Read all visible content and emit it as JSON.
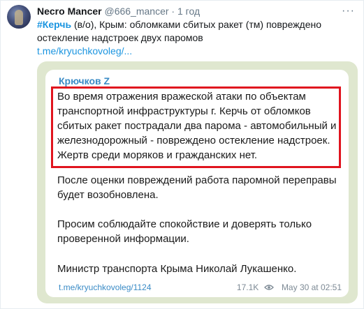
{
  "tweet": {
    "author_name": "Necro Mancer",
    "author_handle": "@666_mancer",
    "separator": " · ",
    "time": "1 год",
    "hashtag": "#Керчь",
    "text": " (в/о), Крым: обломками сбитых ракет (тм) повреждено остекление надстроек двух паромов",
    "link": "t.me/kryuchkovoleg/..."
  },
  "telegram_post": {
    "channel": "Крючков Z",
    "paragraphs": [
      "Во время отражения вражеской атаки по объектам транспортной инфраструктуры г. Керчь от обломков сбитых ракет пострадали два парома - автомобильный и железнодорожный - повреждено остекление надстроек. Жертв среди моряков и гражданских нет.",
      "После оценки повреждений работа паромной переправы будет возобновлена.",
      "Просим соблюдайте спокойствие и доверять только проверенной информации.",
      "Министр транспорта Крыма Николай Лукашенко."
    ],
    "source_link": "t.me/kryuchkovoleg/1124",
    "views": "17.1K",
    "date": "May 30 at 02:51"
  },
  "icons": {
    "more": "more-dots-icon",
    "views": "eye-icon"
  },
  "colors": {
    "accent": "#1b95e0",
    "highlight_border": "#e0141e",
    "telegram_bg": "#dfe7cf",
    "channel_name": "#3a8bc6"
  }
}
